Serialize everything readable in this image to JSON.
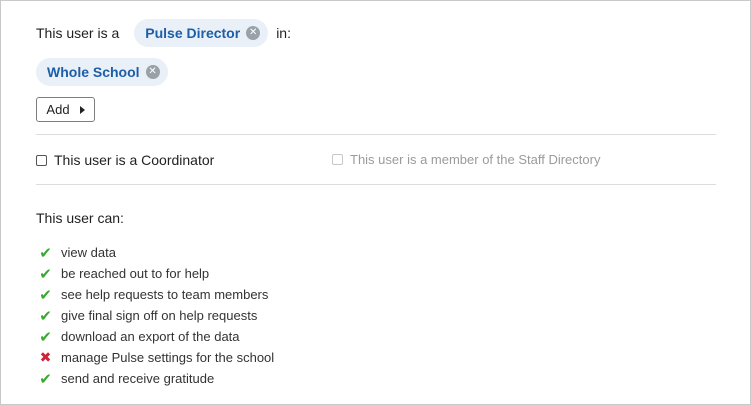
{
  "role": {
    "prefix": "This user is a",
    "role_name": "Pulse Director",
    "suffix": "in:",
    "scope": "Whole School"
  },
  "add_button": {
    "label": "Add"
  },
  "coordinator": {
    "label": "This user is a Coordinator",
    "checked": false
  },
  "staff_directory": {
    "label": "This user is a member of the Staff Directory",
    "checked": false,
    "disabled": true
  },
  "permissions": {
    "heading": "This user can:",
    "items": [
      {
        "label": "view data",
        "allowed": true
      },
      {
        "label": "be reached out to for help",
        "allowed": true
      },
      {
        "label": "see help requests to team members",
        "allowed": true
      },
      {
        "label": "give final sign off on help requests",
        "allowed": true
      },
      {
        "label": "download an export of the data",
        "allowed": true
      },
      {
        "label": "manage Pulse settings for the school",
        "allowed": false
      },
      {
        "label": "send and receive gratitude",
        "allowed": true
      }
    ]
  },
  "colors": {
    "chip_text": "#1d5ea8",
    "chip_bg": "#eaf0f7",
    "check": "#3aa832",
    "cross": "#d0243a"
  }
}
